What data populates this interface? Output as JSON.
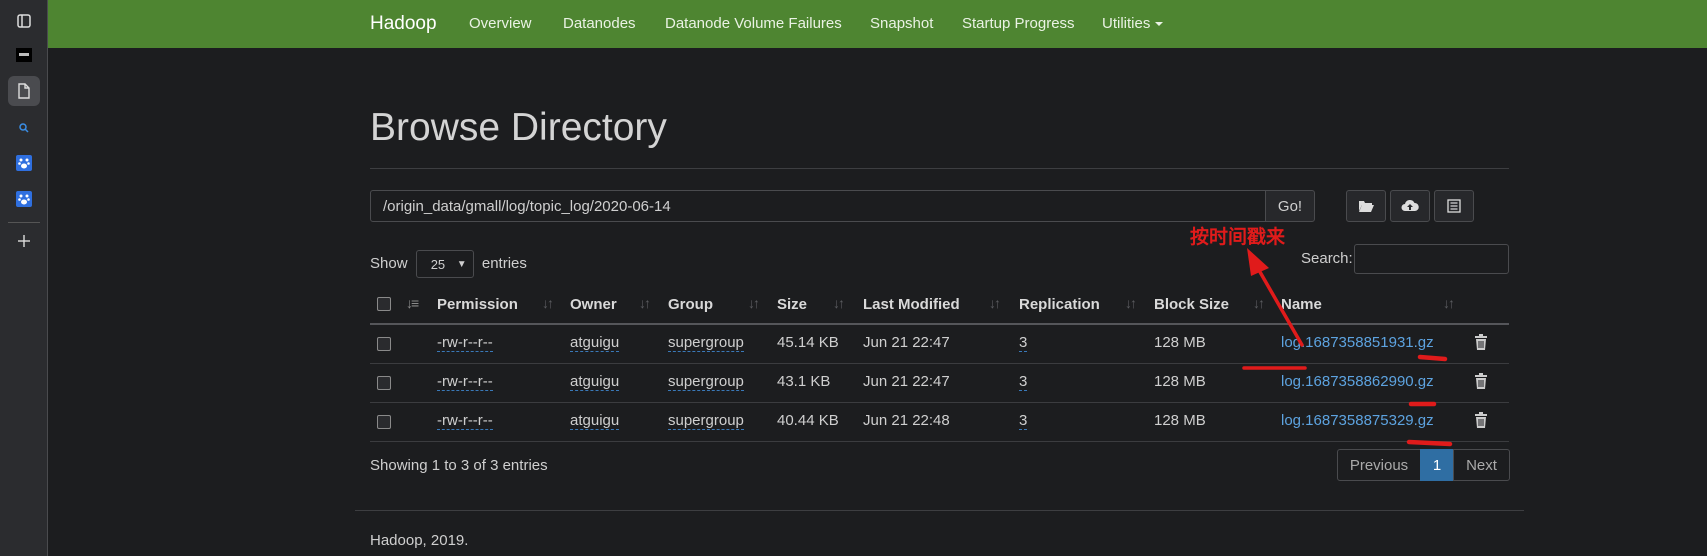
{
  "navbar": {
    "brand": "Hadoop",
    "links": [
      "Overview",
      "Datanodes",
      "Datanode Volume Failures",
      "Snapshot",
      "Startup Progress",
      "Utilities"
    ],
    "color": "#4e8531"
  },
  "sidebar": {
    "icons": [
      "tab-panel-icon",
      "app-thumbnail-icon",
      "document-icon",
      "search-icon",
      "baidu-paw-icon",
      "baidu-paw-icon",
      "plus-icon"
    ]
  },
  "page": {
    "title": "Browse Directory",
    "path": "/origin_data/gmall/log/topic_log/2020-06-14",
    "go_label": "Go!",
    "show_label": "Show",
    "entries_value": "25",
    "entries_label": "entries",
    "search_label": "Search:"
  },
  "table": {
    "headers": [
      "Permission",
      "Owner",
      "Group",
      "Size",
      "Last Modified",
      "Replication",
      "Block Size",
      "Name"
    ],
    "rows": [
      {
        "permission": "-rw-r--r--",
        "owner": "atguigu",
        "group": "supergroup",
        "size": "45.14 KB",
        "modified": "Jun 21 22:47",
        "replication": "3",
        "block_size": "128 MB",
        "name": "log.1687358851931.gz"
      },
      {
        "permission": "-rw-r--r--",
        "owner": "atguigu",
        "group": "supergroup",
        "size": "43.1 KB",
        "modified": "Jun 21 22:47",
        "replication": "3",
        "block_size": "128 MB",
        "name": "log.1687358862990.gz"
      },
      {
        "permission": "-rw-r--r--",
        "owner": "atguigu",
        "group": "supergroup",
        "size": "40.44 KB",
        "modified": "Jun 21 22:48",
        "replication": "3",
        "block_size": "128 MB",
        "name": "log.1687358875329.gz"
      }
    ]
  },
  "footer_info": {
    "showing": "Showing 1 to 3 of 3 entries",
    "prev": "Previous",
    "page": "1",
    "next": "Next",
    "copyright": "Hadoop, 2019."
  },
  "annotation": {
    "text": "按时间戳来",
    "color": "#e01b1b"
  },
  "colors": {
    "link": "#5da3e0",
    "active_page": "#2f6ea3"
  }
}
